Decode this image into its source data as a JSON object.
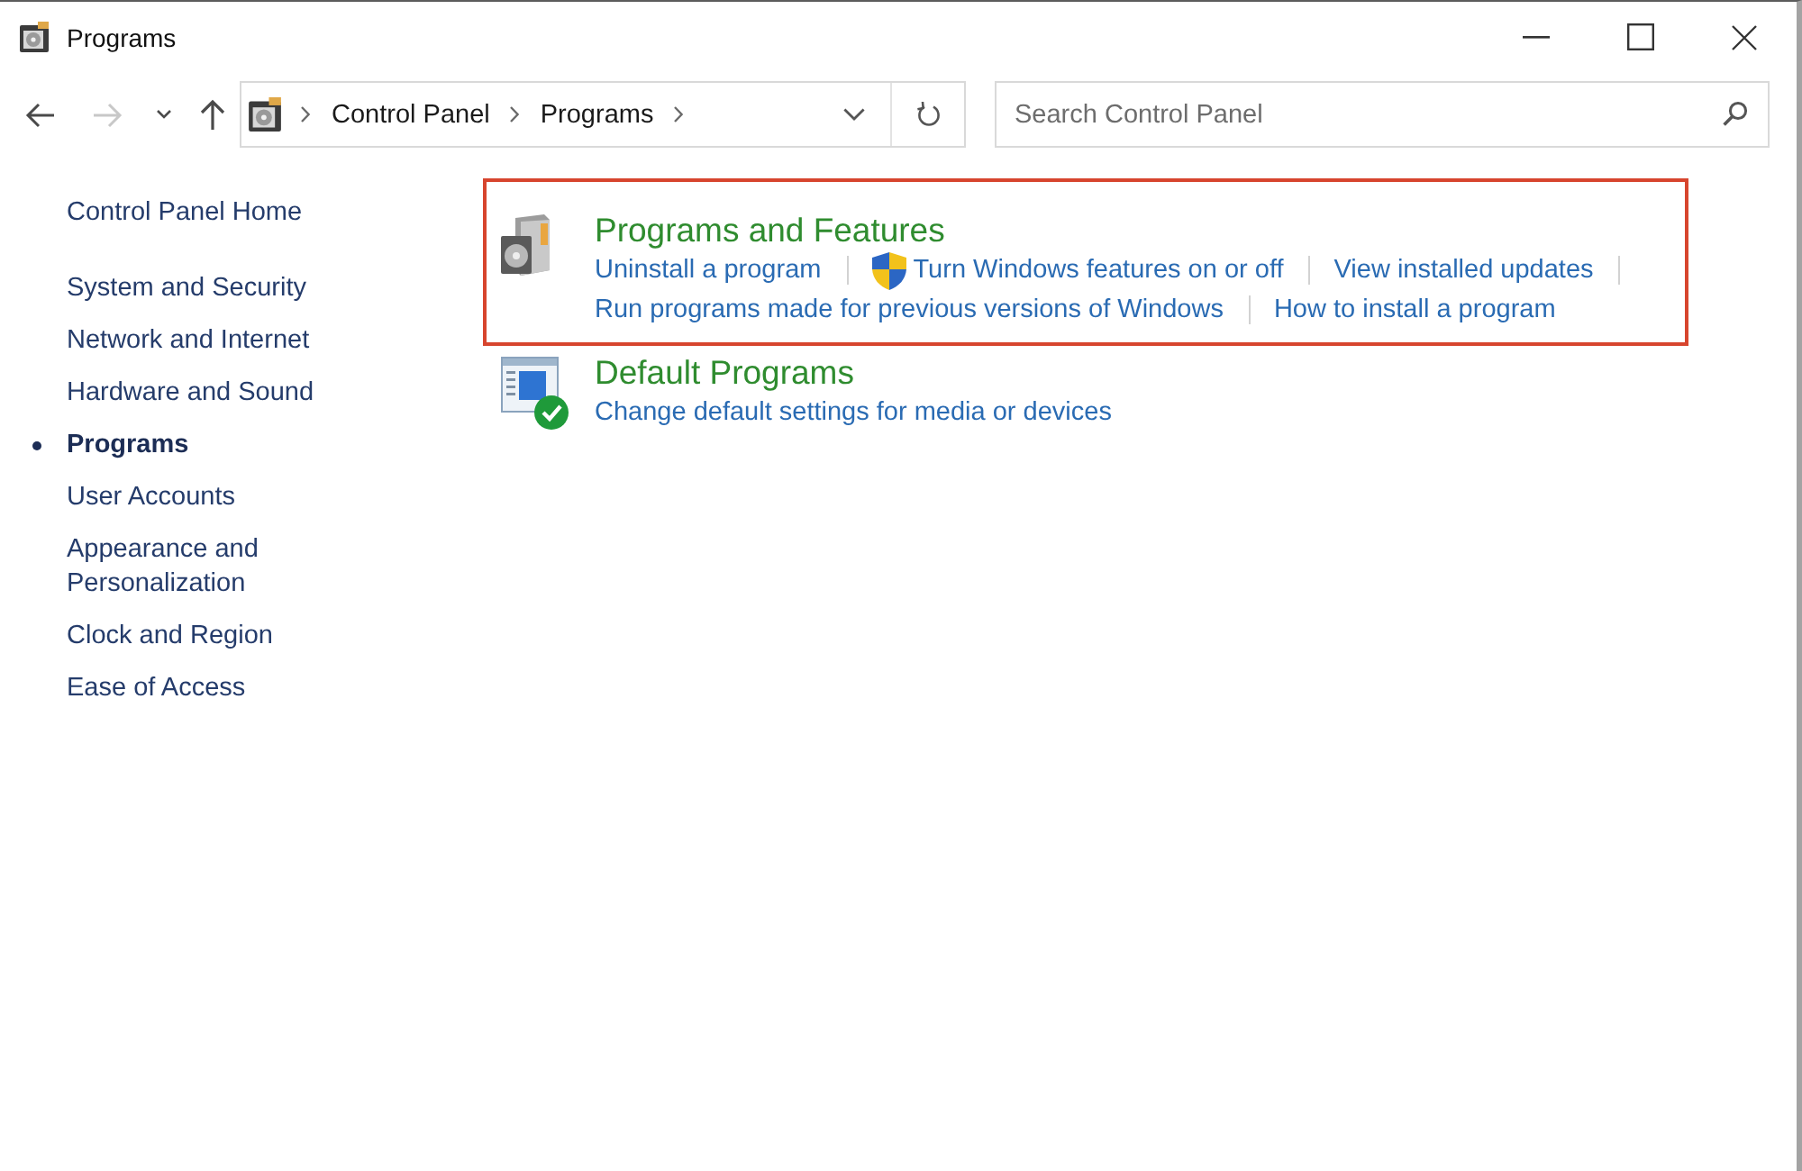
{
  "window": {
    "title": "Programs"
  },
  "navigation": {
    "buttons": [
      {
        "kind": "back",
        "disabled": false
      },
      {
        "kind": "forward",
        "disabled": true
      },
      {
        "kind": "recent",
        "disabled": false
      },
      {
        "kind": "up",
        "disabled": false
      }
    ]
  },
  "address_bar": {
    "breadcrumb": [
      "Control Panel",
      "Programs"
    ]
  },
  "search": {
    "placeholder": "Search Control Panel"
  },
  "sidebar": {
    "home": "Control Panel Home",
    "items": [
      {
        "label": "System and Security",
        "selected": false
      },
      {
        "label": "Network and Internet",
        "selected": false
      },
      {
        "label": "Hardware and Sound",
        "selected": false
      },
      {
        "label": "Programs",
        "selected": true
      },
      {
        "label": "User Accounts",
        "selected": false
      },
      {
        "label": "Appearance and Personalization",
        "selected": false
      },
      {
        "label": "Clock and Region",
        "selected": false
      },
      {
        "label": "Ease of Access",
        "selected": false
      }
    ]
  },
  "categories": [
    {
      "title": "Programs and Features",
      "highlighted": true,
      "link_rows": [
        [
          {
            "label": "Uninstall a program",
            "kind": "plain"
          },
          {
            "label": "Turn Windows features on or off",
            "kind": "shield"
          },
          {
            "label": "View installed updates",
            "kind": "plain"
          }
        ],
        [
          {
            "label": "Run programs made for previous versions of Windows",
            "kind": "plain"
          },
          {
            "label": "How to install a program",
            "kind": "plain"
          }
        ]
      ]
    },
    {
      "title": "Default Programs",
      "highlighted": false,
      "link_rows": [
        [
          {
            "label": "Change default settings for media or devices",
            "kind": "plain"
          }
        ]
      ]
    }
  ]
}
